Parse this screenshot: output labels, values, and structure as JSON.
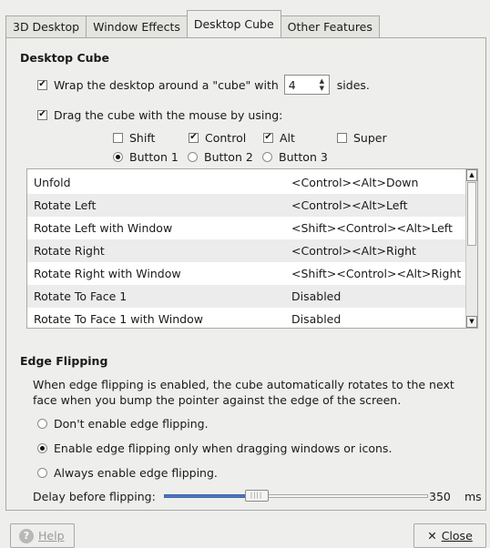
{
  "tabs": [
    "3D Desktop",
    "Window Effects",
    "Desktop Cube",
    "Other Features"
  ],
  "cube": {
    "title": "Desktop Cube",
    "wrap_pre": "Wrap the desktop around a \"cube\" with",
    "sides_value": "4",
    "wrap_post": "sides.",
    "wrap_checked": true,
    "drag_label": "Drag the cube with the mouse by using:",
    "drag_checked": true,
    "modifiers": [
      {
        "label": "Shift",
        "checked": false
      },
      {
        "label": "Control",
        "checked": true
      },
      {
        "label": "Alt",
        "checked": true
      },
      {
        "label": "Super",
        "checked": false
      }
    ],
    "buttons": [
      {
        "label": "Button 1",
        "selected": true
      },
      {
        "label": "Button 2",
        "selected": false
      },
      {
        "label": "Button 3",
        "selected": false
      }
    ]
  },
  "keybindings": [
    {
      "action": "Unfold",
      "shortcut": "<Control><Alt>Down"
    },
    {
      "action": "Rotate Left",
      "shortcut": "<Control><Alt>Left"
    },
    {
      "action": "Rotate Left with Window",
      "shortcut": "<Shift><Control><Alt>Left"
    },
    {
      "action": "Rotate Right",
      "shortcut": "<Control><Alt>Right"
    },
    {
      "action": "Rotate Right with Window",
      "shortcut": "<Shift><Control><Alt>Right"
    },
    {
      "action": "Rotate To Face 1",
      "shortcut": "Disabled"
    },
    {
      "action": "Rotate To Face 1 with Window",
      "shortcut": "Disabled"
    }
  ],
  "edge": {
    "title": "Edge Flipping",
    "description": "When edge flipping is enabled, the cube automatically rotates to the next face when you bump the pointer against the edge of the screen.",
    "options": [
      {
        "label": "Don't enable edge flipping.",
        "selected": false
      },
      {
        "label": "Enable edge flipping only when dragging windows or icons.",
        "selected": true
      },
      {
        "label": "Always enable edge flipping.",
        "selected": false
      }
    ],
    "delay_label": "Delay before flipping:",
    "delay_value": "350",
    "delay_unit": "ms",
    "delay_fraction": 0.35
  },
  "footer": {
    "help_label": "Help",
    "close_label": "Close"
  }
}
